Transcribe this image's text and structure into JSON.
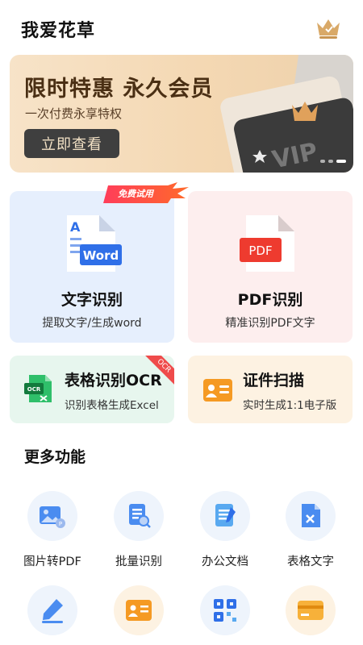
{
  "header": {
    "title": "我爱花草",
    "crown_icon": "crown-icon"
  },
  "banner": {
    "title": "限时特惠 永久会员",
    "subtitle": "一次付费永享特权",
    "button_label": "立即查看",
    "art_text": "VIP",
    "dots": 3,
    "active_dot": 3
  },
  "cards": {
    "word": {
      "title": "文字识别",
      "subtitle": "提取文字/生成word",
      "icon_text": "Word",
      "badge": "免费试用"
    },
    "pdf": {
      "title": "PDF识别",
      "subtitle": "精准识别PDF文字",
      "icon_text": "PDF"
    },
    "ocr": {
      "title": "表格识别OCR",
      "subtitle": "识别表格生成Excel",
      "ribbon": "OCR",
      "icon_text": "OCR"
    },
    "id": {
      "title": "证件扫描",
      "subtitle": "实时生成1:1电子版"
    }
  },
  "more": {
    "title": "更多功能",
    "items": [
      {
        "label": "图片转PDF",
        "icon": "image-to-pdf-icon"
      },
      {
        "label": "批量识别",
        "icon": "batch-scan-icon"
      },
      {
        "label": "办公文档",
        "icon": "office-doc-icon"
      },
      {
        "label": "表格文字",
        "icon": "table-text-icon"
      },
      {
        "label": "",
        "icon": "handwriting-icon"
      },
      {
        "label": "",
        "icon": "id-card-icon"
      },
      {
        "label": "",
        "icon": "qr-scan-icon"
      },
      {
        "label": "",
        "icon": "bank-card-icon"
      }
    ]
  },
  "colors": {
    "banner_gradient_start": "#f7e3c8",
    "word_card_bg": "#e6effd",
    "pdf_card_bg": "#fdeeee",
    "ocr_card_bg": "#e7f6ee",
    "id_card_bg": "#fdf2e2",
    "primary_blue": "#2f6fe8",
    "pdf_red": "#ee3b2f"
  }
}
